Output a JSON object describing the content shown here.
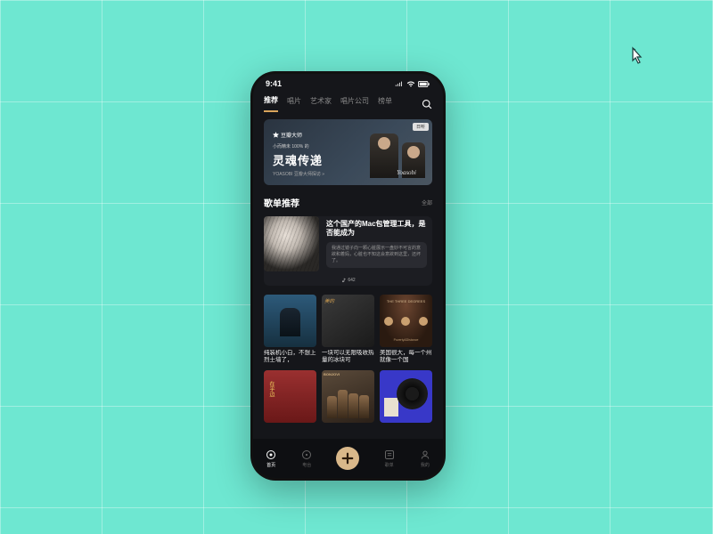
{
  "status": {
    "time": "9:41"
  },
  "tabs": {
    "items": [
      "推荐",
      "唱片",
      "艺术家",
      "唱片公司",
      "榜单"
    ],
    "active_index": 0
  },
  "hero": {
    "badge": "豆瓣大师",
    "subtitle": "小而精未 100% 的",
    "title": "灵魂传递",
    "footer": "YOASOBI 豆瓣大师探访 »",
    "signature": "Yoasobi",
    "tag": "日听"
  },
  "section": {
    "title": "歌单推荐",
    "more": "全部"
  },
  "feature": {
    "title": "这个国产的Mac包管理工具，是否能成为",
    "desc": "我通过镜子向一颗心脏展示一盘妙不可言的意欲和着妈，心脏也不知这会意欲到这里，还坏了。",
    "count": "642"
  },
  "cards_row1": [
    {
      "title": "纯装机小白，不想上烈士墙了，",
      "album_text": ""
    },
    {
      "title": "一块可以无限吸收热量的冰块可",
      "album_text": "美的"
    },
    {
      "title": "美国很大，每一个州就像一个国",
      "album_line1": "THE THREE DEGREES",
      "album_line2": "Poverty&Distance"
    }
  ],
  "cards_row2": [
    {
      "album_text": "在乎边"
    },
    {
      "album_text": "BONJOVI"
    },
    {
      "album_text": ""
    }
  ],
  "nav": {
    "items": [
      {
        "label": "首页",
        "icon": "home"
      },
      {
        "label": "电台",
        "icon": "disc"
      },
      {
        "label": "",
        "icon": "add"
      },
      {
        "label": "歌单",
        "icon": "notes"
      },
      {
        "label": "我的",
        "icon": "user"
      }
    ],
    "active_index": 0
  }
}
